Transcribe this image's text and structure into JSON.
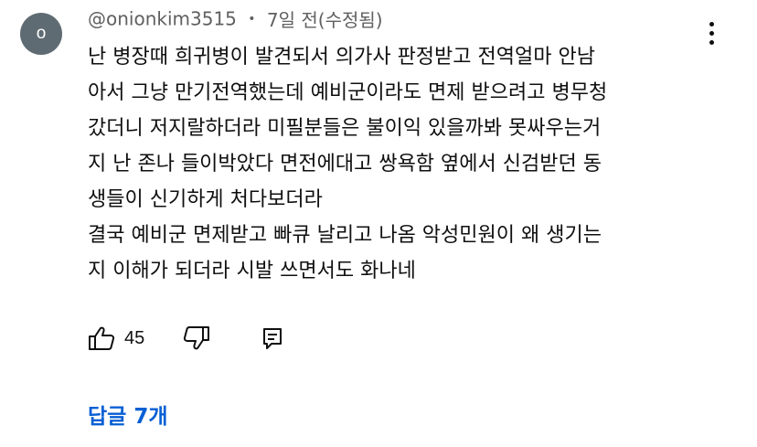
{
  "comment": {
    "avatar_letter": "o",
    "author": "@onionkim3515",
    "separator": "•",
    "time": "7일 전(수정됨)",
    "lines": [
      "난 병장때 희귀병이 발견되서 의가사 판정받고 전역얼마 안남",
      "아서 그냥 만기전역했는데 예비군이라도 면제 받으려고 병무청",
      "갔더니 저지랄하더라 미필분들은 불이익 있을까봐 못싸우는거",
      "지 난 존나 들이박았다 면전에대고 쌍욕함 옆에서 신검받던 동",
      "생들이 신기하게 처다보더라",
      "결국 예비군 면제받고 빠큐 날리고 나옴 악성민원이 왜 생기는",
      "지 이해가 되더라 시발 쓰면서도 화나네"
    ]
  },
  "actions": {
    "like_count": "45",
    "icons": [
      "thumbs-up-icon",
      "thumbs-down-icon",
      "reply-icon",
      "more-vert-icon"
    ]
  },
  "replies": {
    "label": "답글 7개"
  },
  "colors": {
    "link": "#065fd4",
    "meta": "#606060",
    "text": "#0f0f0f",
    "avatar": "#5f6b73"
  }
}
